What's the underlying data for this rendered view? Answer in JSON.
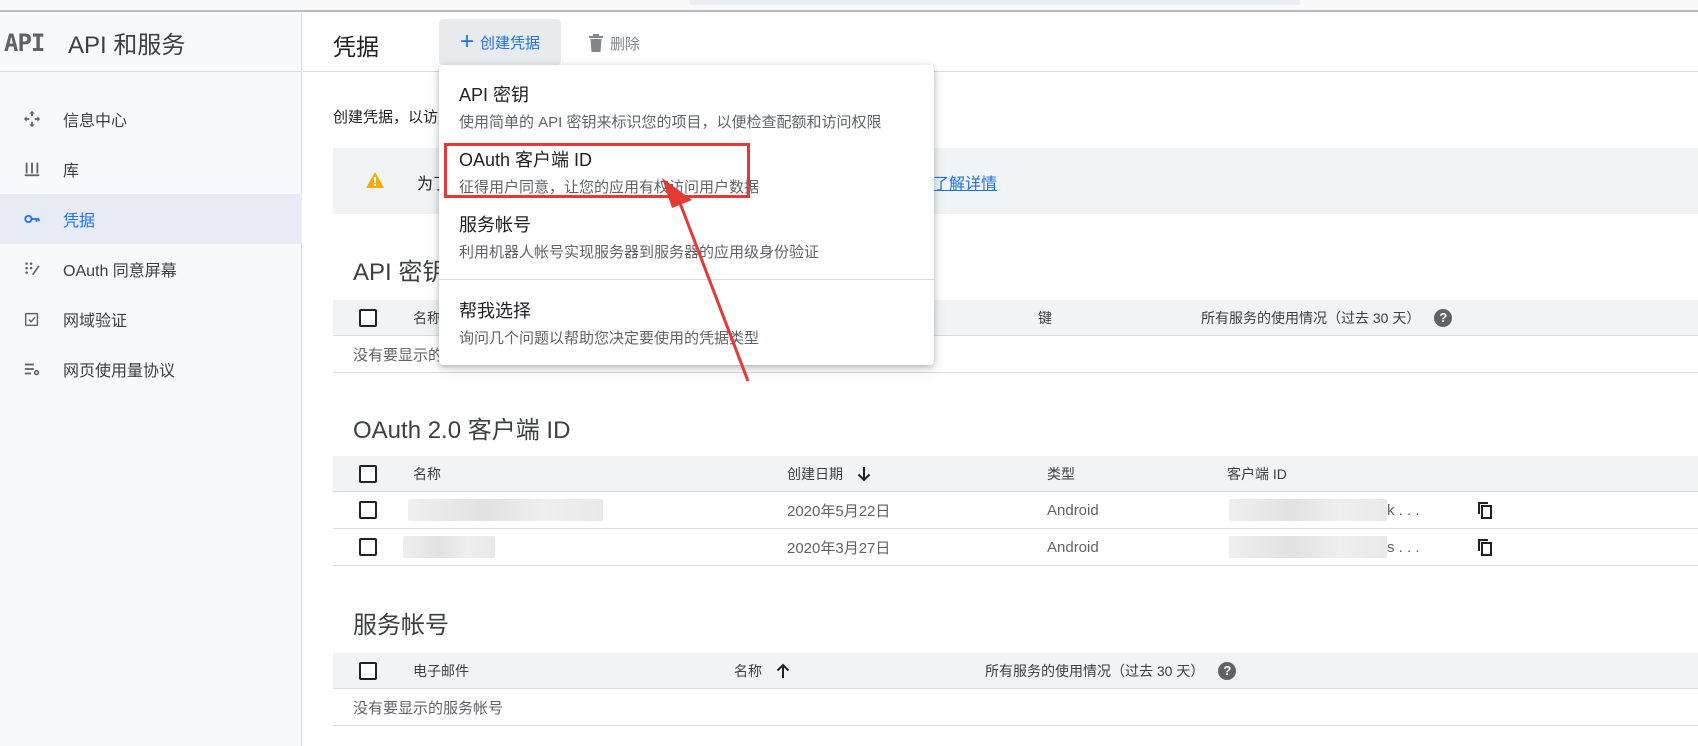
{
  "sidebar": {
    "logo": "API",
    "title": "API 和服务",
    "items": [
      {
        "label": "信息中心",
        "active": false
      },
      {
        "label": "库",
        "active": false
      },
      {
        "label": "凭据",
        "active": true
      },
      {
        "label": "OAuth 同意屏幕",
        "active": false
      },
      {
        "label": "网域验证",
        "active": false
      },
      {
        "label": "网页使用量协议",
        "active": false
      }
    ]
  },
  "header": {
    "title": "凭据",
    "create_label": "创建凭据",
    "delete_label": "删除"
  },
  "intro": "创建凭据，以访",
  "warning": {
    "text": "为了",
    "link": "了解详情"
  },
  "dropdown": {
    "items": [
      {
        "title": "API 密钥",
        "desc": "使用简单的 API 密钥来标识您的项目，以便检查配额和访问权限"
      },
      {
        "title": "OAuth 客户端 ID",
        "desc": "征得用户同意，让您的应用有权访问用户数据"
      },
      {
        "title": "服务帐号",
        "desc": "利用机器人帐号实现服务器到服务器的应用级身份验证"
      },
      {
        "title": "帮我选择",
        "desc": "询问几个问题以帮助您决定要使用的凭据类型"
      }
    ]
  },
  "api_keys": {
    "title": "API 密钥",
    "columns": {
      "name": "名称",
      "key": "键",
      "usage": "所有服务的使用情况（过去 30 天）"
    },
    "empty": "没有要显示的"
  },
  "oauth": {
    "title": "OAuth 2.0 客户端 ID",
    "columns": {
      "name": "名称",
      "date": "创建日期",
      "type": "类型",
      "client_id": "客户端 ID"
    },
    "rows": [
      {
        "date": "2020年5月22日",
        "type": "Android",
        "client_id_suffix": "k . . ."
      },
      {
        "date": "2020年3月27日",
        "type": "Android",
        "client_id_suffix": "s . . ."
      }
    ]
  },
  "service_accounts": {
    "title": "服务帐号",
    "columns": {
      "email": "电子邮件",
      "name": "名称",
      "usage": "所有服务的使用情况（过去 30 天）"
    },
    "empty": "没有要显示的服务帐号"
  },
  "colors": {
    "accent": "#1a73e8",
    "highlight": "#e53935",
    "warning": "#f9ab00"
  }
}
